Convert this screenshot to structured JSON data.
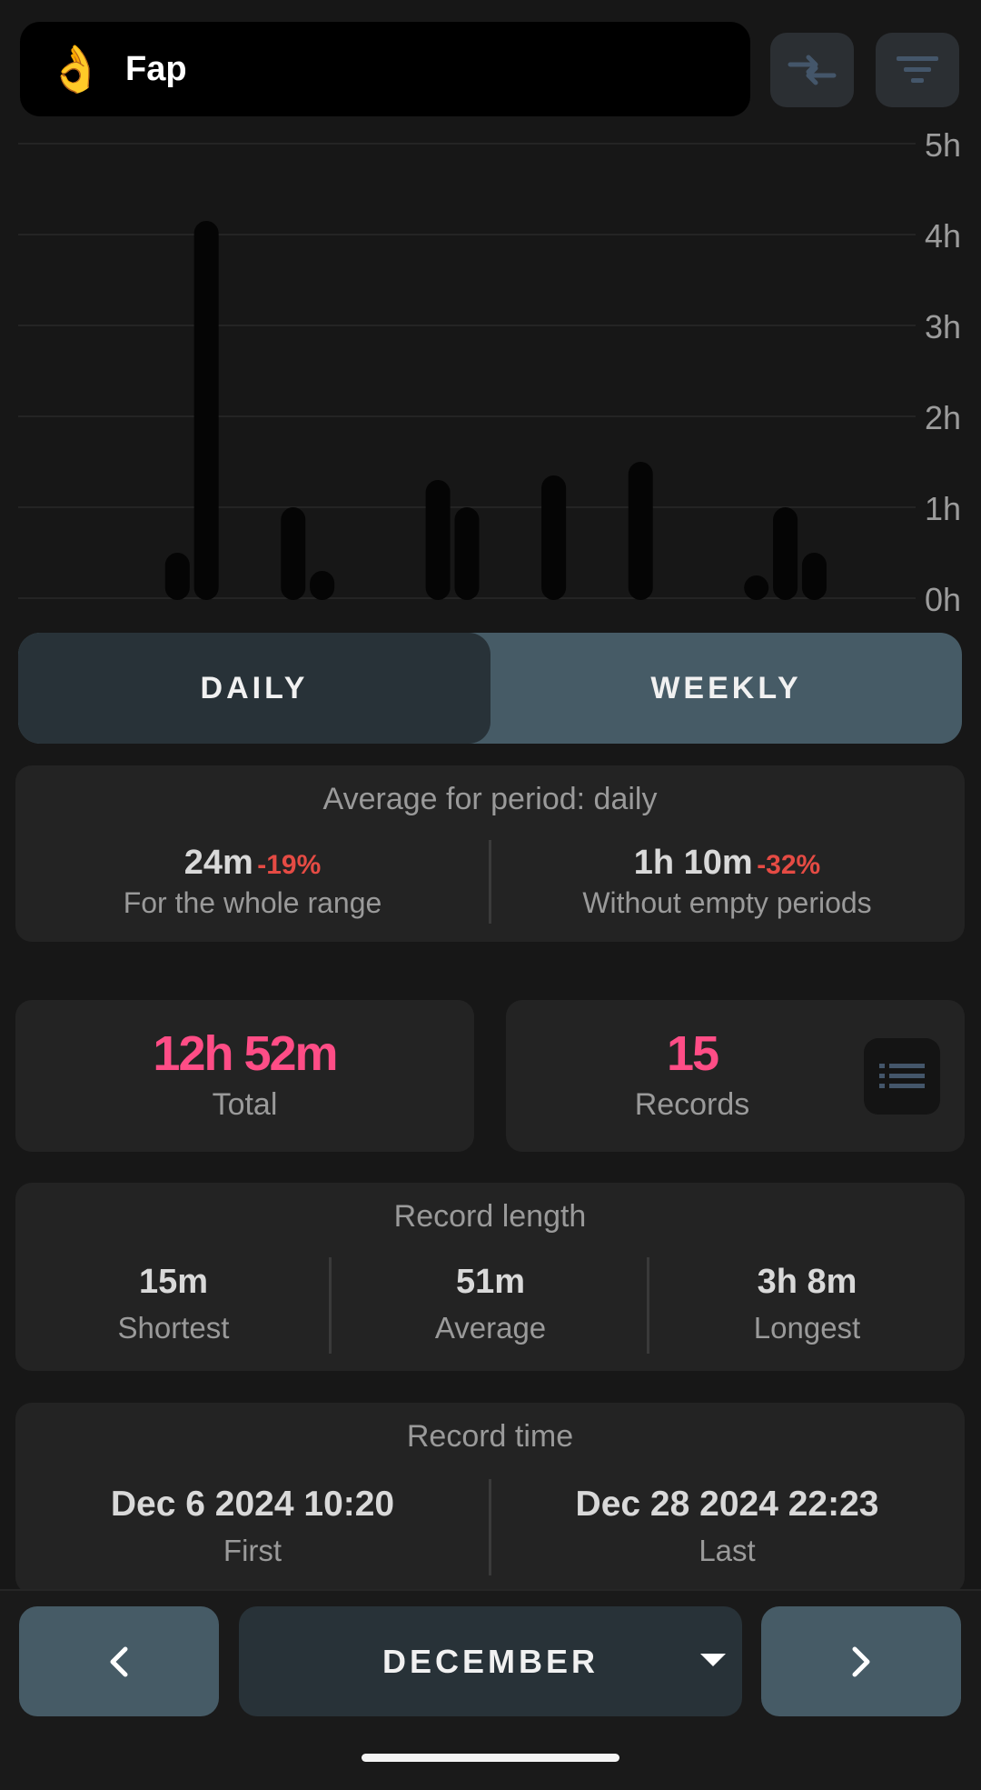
{
  "header": {
    "emoji": "👌",
    "title": "Fap",
    "swap_icon": "swap-arrows-icon",
    "filter_icon": "filter-icon"
  },
  "chart_data": {
    "type": "bar",
    "y_ticks": [
      "5h",
      "4h",
      "3h",
      "2h",
      "1h",
      "0h"
    ],
    "ylim": [
      0,
      5
    ],
    "unit": "hours",
    "bars": [
      {
        "day": 6,
        "value": 0.5
      },
      {
        "day": 7,
        "value": 4.15
      },
      {
        "day": 10,
        "value": 1.0
      },
      {
        "day": 11,
        "value": 0.3
      },
      {
        "day": 15,
        "value": 1.3
      },
      {
        "day": 16,
        "value": 1.0
      },
      {
        "day": 19,
        "value": 1.35
      },
      {
        "day": 22,
        "value": 1.5
      },
      {
        "day": 26,
        "value": 0.25
      },
      {
        "day": 27,
        "value": 1.0
      },
      {
        "day": 28,
        "value": 0.5
      }
    ],
    "days_in_range": 31,
    "bar_color": "#050505",
    "grid": true
  },
  "period_toggle": {
    "daily": "DAILY",
    "weekly": "WEEKLY",
    "selected": "DAILY"
  },
  "average": {
    "heading": "Average for period: daily",
    "left": {
      "value": "24m",
      "change": "-19%",
      "label": "For the whole range"
    },
    "right": {
      "value": "1h 10m",
      "change": "-32%",
      "label": "Without empty periods"
    }
  },
  "totals": {
    "total_value": "12h 52m",
    "total_label": "Total",
    "records_value": "15",
    "records_label": "Records",
    "list_icon": "list-icon"
  },
  "record_length": {
    "heading": "Record length",
    "items": [
      {
        "value": "15m",
        "label": "Shortest"
      },
      {
        "value": "51m",
        "label": "Average"
      },
      {
        "value": "3h 8m",
        "label": "Longest"
      }
    ]
  },
  "record_time": {
    "heading": "Record time",
    "first": {
      "value": "Dec 6 2024 10:20",
      "label": "First"
    },
    "last": {
      "value": "Dec 28 2024 22:23",
      "label": "Last"
    }
  },
  "navigation": {
    "month": "DECEMBER",
    "prev_icon": "chevron-left-icon",
    "next_icon": "chevron-right-icon",
    "dropdown_icon": "caret-down-icon"
  },
  "colors": {
    "accent": "#ff4d86",
    "negative": "#e54b44",
    "card": "#232323",
    "toggle_selected": "#283238",
    "toggle_bg": "#465b66"
  }
}
